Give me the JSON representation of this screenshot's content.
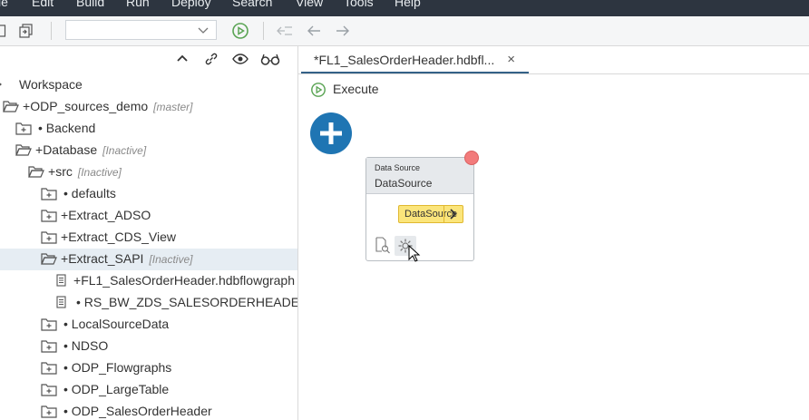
{
  "menubar": {
    "items": [
      "le",
      "Edit",
      "Build",
      "Run",
      "Deploy",
      "Search",
      "View",
      "Tools",
      "Help"
    ]
  },
  "toolbar": {
    "icons": [
      "save-icon",
      "save-all-icon",
      "run-icon",
      "back-disabled-icon",
      "back-icon",
      "forward-icon"
    ],
    "combo_value": ""
  },
  "workspace": {
    "header_icons": [
      "collapse-icon",
      "link-icon",
      "show-hidden-icon",
      "glasses-icon"
    ],
    "tree": [
      {
        "label": "Workspace",
        "status": "",
        "indicator": ""
      },
      {
        "label": "ODP_sources_demo",
        "status": "[master]",
        "indicator": "+"
      },
      {
        "label": "Backend",
        "status": "",
        "indicator": "•"
      },
      {
        "label": "Database",
        "status": "[Inactive]",
        "indicator": "+"
      },
      {
        "label": "src",
        "status": "[Inactive]",
        "indicator": "+"
      },
      {
        "label": "defaults",
        "status": "",
        "indicator": "•"
      },
      {
        "label": "Extract_ADSO",
        "status": "",
        "indicator": "+"
      },
      {
        "label": "Extract_CDS_View",
        "status": "",
        "indicator": "+"
      },
      {
        "label": "Extract_SAPI",
        "status": "[Inactive]",
        "indicator": "+"
      },
      {
        "label": "FL1_SalesOrderHeader.hdbflowgraph",
        "status": "",
        "indicator": "+"
      },
      {
        "label": "RS_BW_ZDS_SALESORDERHEADE",
        "status": "",
        "indicator": "•"
      },
      {
        "label": "LocalSourceData",
        "status": "",
        "indicator": "•"
      },
      {
        "label": "NDSO",
        "status": "",
        "indicator": "•"
      },
      {
        "label": "ODP_Flowgraphs",
        "status": "",
        "indicator": "•"
      },
      {
        "label": "ODP_LargeTable",
        "status": "",
        "indicator": "•"
      },
      {
        "label": "ODP_SalesOrderHeader",
        "status": "",
        "indicator": "•"
      }
    ]
  },
  "editor": {
    "tab_label": "*FL1_SalesOrderHeader.hdbfl...",
    "tab_close": "×",
    "execute_label": "Execute",
    "node": {
      "type_label": "Data Source",
      "name": "DataSource",
      "port_label": "DataSource",
      "status_color": "#f27b7b"
    }
  },
  "colors": {
    "menubar_bg": "#2d3540",
    "run_green": "#5aa454",
    "accent_blue": "#1f75b3",
    "port_yellow": "#fbe57b"
  }
}
